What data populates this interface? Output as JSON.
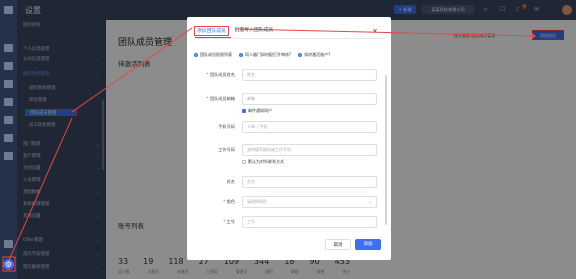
{
  "sidebar": {
    "title": "设置",
    "items": [
      {
        "label": "组织架构",
        "arrow": "›"
      },
      {
        "label": "个人信息管理",
        "arrow": "›"
      },
      {
        "label": "公司信息管理",
        "arrow": "›"
      },
      {
        "label": "组织架构管理",
        "arrow": "›"
      },
      {
        "label": "组织架构管理"
      },
      {
        "label": "岗位管理"
      },
      {
        "label": "团队成员管理"
      },
      {
        "label": "员工角色管理"
      },
      {
        "label": "部门管理",
        "arrow": "›"
      },
      {
        "label": "客户管理",
        "arrow": "›"
      },
      {
        "label": "合同设置",
        "arrow": "›"
      },
      {
        "label": "人员管理",
        "arrow": "›"
      },
      {
        "label": "基础数据",
        "arrow": "›"
      },
      {
        "label": "系统权限管理",
        "arrow": "›"
      },
      {
        "label": "其他设置",
        "arrow": "›"
      },
      {
        "label": "Offer管理",
        "arrow": "›"
      },
      {
        "label": "简历字段管理",
        "arrow": "›"
      },
      {
        "label": "简历解析管理",
        "arrow": "›"
      }
    ]
  },
  "topbar": {
    "new_label": "+ 新建",
    "user_label": "某某科技有限公司",
    "notif_count": "3"
  },
  "main": {
    "title": "团队成员管理",
    "section_title": "待激活列表",
    "account_title": "账号列表",
    "links": "账号管理   团队成员管理",
    "add_member_button": "添加成员",
    "stats": [
      {
        "num": "33",
        "label": "总人数"
      },
      {
        "num": "19",
        "label": "已激活"
      },
      {
        "num": "118",
        "label": "未激活"
      },
      {
        "num": "27",
        "label": "已停用"
      },
      {
        "num": "109",
        "label": "管理员"
      },
      {
        "num": "344",
        "label": "顾问"
      },
      {
        "num": "18",
        "label": "助理"
      },
      {
        "num": "90",
        "label": "其他"
      },
      {
        "num": "453",
        "label": "合计"
      }
    ]
  },
  "dialog": {
    "tab_add": "添加团队成员",
    "tab_batch": "批量导入团队成员",
    "close": "×",
    "tips": [
      "团队成员权限列表",
      "同人器门如何配打开审核?",
      "如何激活账户?"
    ],
    "fields": {
      "name": {
        "label": "团队成员姓名",
        "placeholder": "姓名"
      },
      "email": {
        "label": "团队成员邮箱",
        "placeholder": "邮箱"
      },
      "email_check": "邮件通知同户",
      "phone": {
        "label": "手机号码",
        "prefix": "+86",
        "placeholder": "手机"
      },
      "work_phone": {
        "label": "工作号码",
        "placeholder": "支持填写座机或工作手机"
      },
      "default_contact": "默认为对外联系方式",
      "alias": {
        "label": "花名",
        "placeholder": "花名"
      },
      "role": {
        "label": "角色",
        "placeholder": "请选择角色"
      },
      "employee_id": {
        "label": "工号",
        "placeholder": "工号"
      }
    },
    "cancel_label": "取消",
    "save_label": "添加"
  },
  "colors": {
    "accent": "#3d6ff0",
    "annotation": "#e54848",
    "sidebar_bg": "#3a4560"
  }
}
